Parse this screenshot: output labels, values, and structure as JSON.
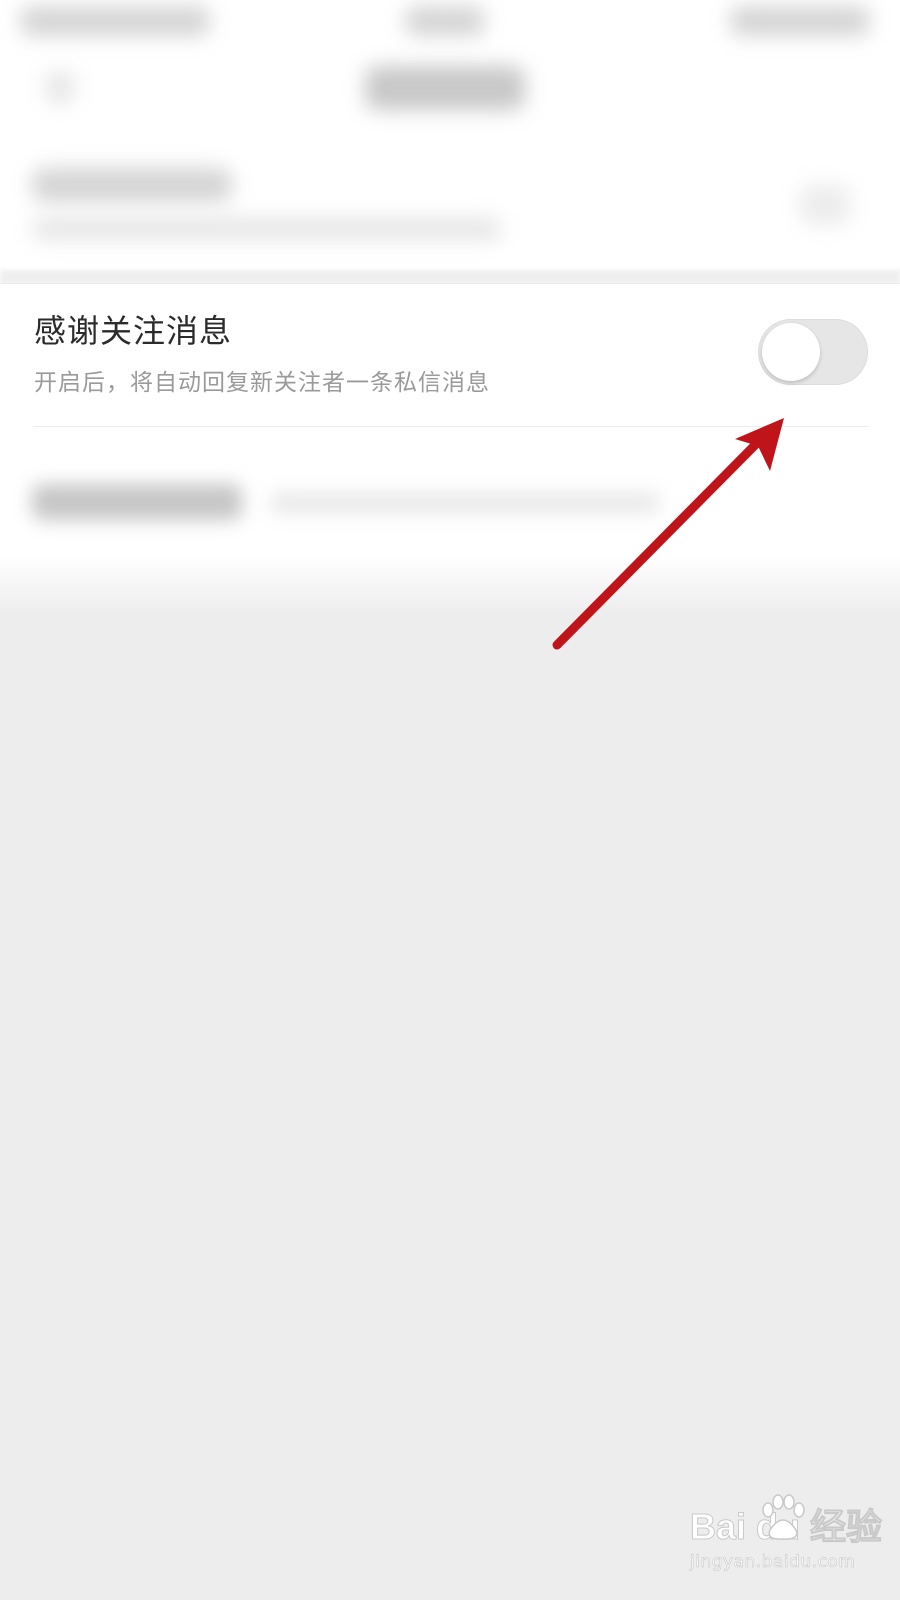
{
  "setting": {
    "title": "感谢关注消息",
    "description": "开启后，将自动回复新关注者一条私信消息",
    "toggle_on": false
  },
  "colors": {
    "arrow": "#c0141b",
    "toggle_track": "#e6e6e6",
    "background": "#ededed"
  },
  "watermark": {
    "logo": "Bai du 经验",
    "site": "jingyan.baidu.com"
  }
}
